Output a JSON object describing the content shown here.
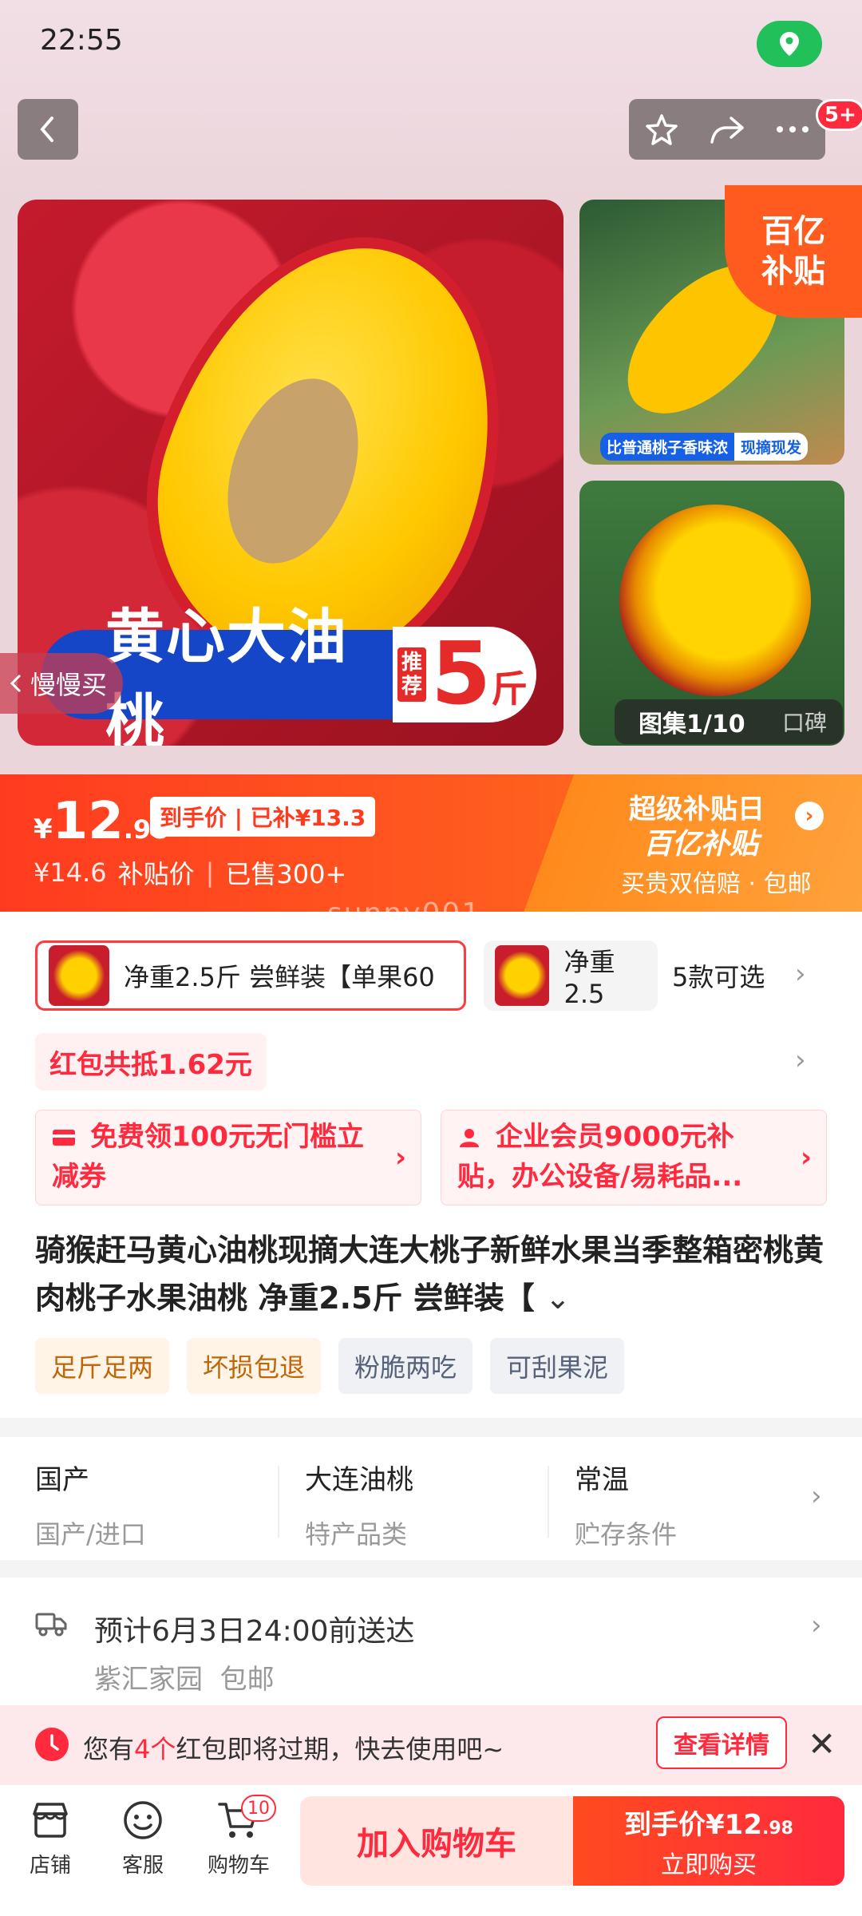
{
  "status": {
    "time": "22:55"
  },
  "header": {
    "more_badge": "5+"
  },
  "gallery": {
    "main_banner_text": "黄心大油桃",
    "main_banner_tuijian": "推荐",
    "main_banner_num": "5",
    "main_banner_unit": "斤",
    "slow_buy": "慢慢买",
    "thumb1_tag_left": "比普通桃子香味浓",
    "thumb1_tag_right": "现摘现发",
    "badge_line1": "百亿",
    "badge_line2": "补贴",
    "count_label": "图集1/10",
    "count_alt": "口碑"
  },
  "price": {
    "currency": "¥",
    "int": "12",
    "dec": ".98",
    "daoshou": "到手价 | 已补¥13.3",
    "original": "¥14.6",
    "subsidy_label": "补贴价",
    "separator": "|",
    "sold": "已售300+",
    "promo_title": "超级补贴日",
    "promo_logo": "百亿补贴",
    "promo_sub": "买贵双倍赔 · 包邮"
  },
  "watermark": "sunny001",
  "sku": {
    "selected": "净重2.5斤 尝鲜装【单果60",
    "other": "净重2.5",
    "count": "5款可选"
  },
  "redpacket": "红包共抵1.62元",
  "coupons": [
    {
      "text": "免费领100元无门槛立减券"
    },
    {
      "text": "企业会员9000元补贴，办公设备/易耗品..."
    }
  ],
  "title": "骑猴赶马黄心油桃现摘大连大桃子新鲜水果当季整箱密桃黄肉桃子水果油桃 净重2.5斤 尝鲜装【",
  "tags": [
    "足斤足两",
    "坏损包退",
    "粉脆两吃",
    "可刮果泥"
  ],
  "specs": [
    {
      "value": "国产",
      "key": "国产/进口"
    },
    {
      "value": "大连油桃",
      "key": "特产品类"
    },
    {
      "value": "常温",
      "key": "贮存条件"
    }
  ],
  "delivery": {
    "eta": "预计6月3日24:00前送达",
    "address": "紫汇家园",
    "shipping": "包邮"
  },
  "notice": {
    "prefix": "您有",
    "count": "4个",
    "suffix": "红包即将过期，快去使用吧~",
    "button": "查看详情"
  },
  "bottom": {
    "shop": "店铺",
    "service": "客服",
    "cart": "购物车",
    "cart_count": "10",
    "add_to_cart": "加入购物车",
    "buy_price_label": "到手价¥12",
    "buy_price_dec": ".98",
    "buy_now": "立即购买"
  },
  "colors": {
    "accent": "#ff2a3d",
    "orange": "#ff5a1f",
    "location": "#22c05a"
  }
}
